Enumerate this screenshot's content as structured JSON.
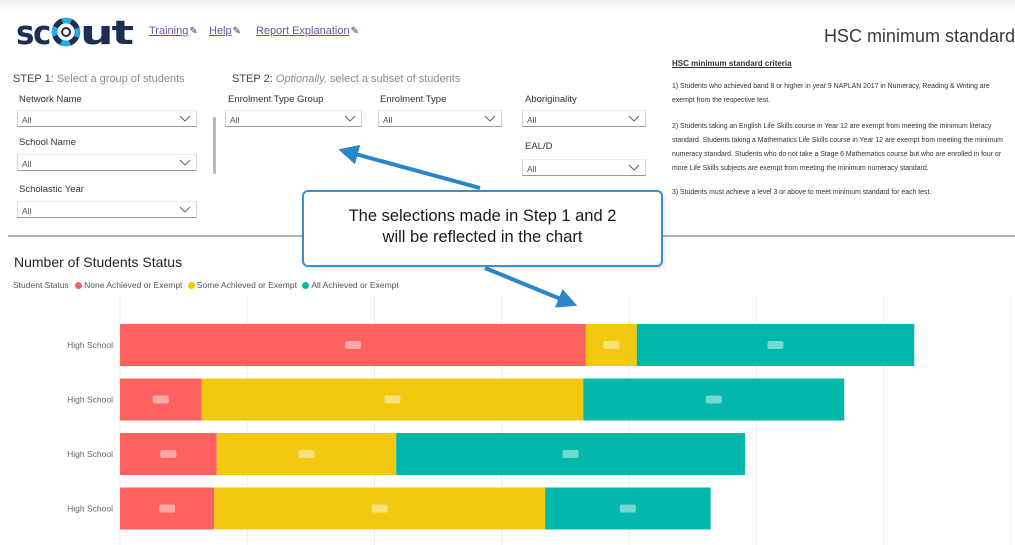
{
  "header": {
    "logo_text": "scout",
    "links": [
      {
        "label": "Training"
      },
      {
        "label": "Help"
      },
      {
        "label": "Report Explanation"
      }
    ],
    "page_title": "HSC minimum standard"
  },
  "step1": {
    "heading": "STEP 1:",
    "hint": "Select a group of students",
    "filters": [
      {
        "label": "Network Name",
        "value": "All"
      },
      {
        "label": "School Name",
        "value": "All"
      },
      {
        "label": "Scholastic Year",
        "value": "All"
      }
    ]
  },
  "step2": {
    "heading": "STEP 2:",
    "hint_emph": "Optionally,",
    "hint_rest": "select a subset of students",
    "filters": [
      {
        "label": "Enrolment Type Group",
        "value": "All"
      },
      {
        "label": "Enrolment Type",
        "value": "All"
      },
      {
        "label": "Aboriginality",
        "value": "All"
      },
      {
        "label": "EAL/D",
        "value": "All"
      }
    ]
  },
  "criteria": {
    "title": "HSC minimum standard criteria",
    "items": [
      "1) Students who achieved band 8 or higher in year 9 NAPLAN 2017 in Numeracy, Reading & Writing are exempt from the respective test.",
      "2) Students taking an English Life Skills course in Year 12 are exempt from meeting the minimum literacy standard.   Students taking a Mathematics Life Skills course in Year 12 are exempt from meeting the minimum numeracy standard.  Students who do not take a Stage 6 Mathematics course but who are enrolled in four or more Life Skills subjects are exempt from meeting the minimum numeracy standard.",
      "3) Students must achieve a level 3 or above to meet minimum standard for each test."
    ]
  },
  "callout": {
    "line1": "The selections made in Step 1 and 2",
    "line2": "will be reflected in the chart"
  },
  "chart_data": {
    "type": "bar",
    "orientation": "horizontal",
    "stacked": true,
    "title": "Number of Students Status",
    "legend_title": "Student Status",
    "legend_position": "top-left",
    "grid": true,
    "categories": [
      "High School",
      "High School",
      "High School",
      "High School"
    ],
    "series": [
      {
        "name": "None Achieved or Exempt",
        "color": "#fd625e",
        "values": [
          366,
          64,
          76,
          74
        ]
      },
      {
        "name": "Some Achieved or Exempt",
        "color": "#f2c811",
        "values": [
          40,
          300,
          141,
          260
        ]
      },
      {
        "name": "All Achieved or Exempt",
        "color": "#01b8aa",
        "values": [
          218,
          205,
          274,
          130
        ]
      }
    ],
    "xlim": [
      0,
      700
    ]
  }
}
